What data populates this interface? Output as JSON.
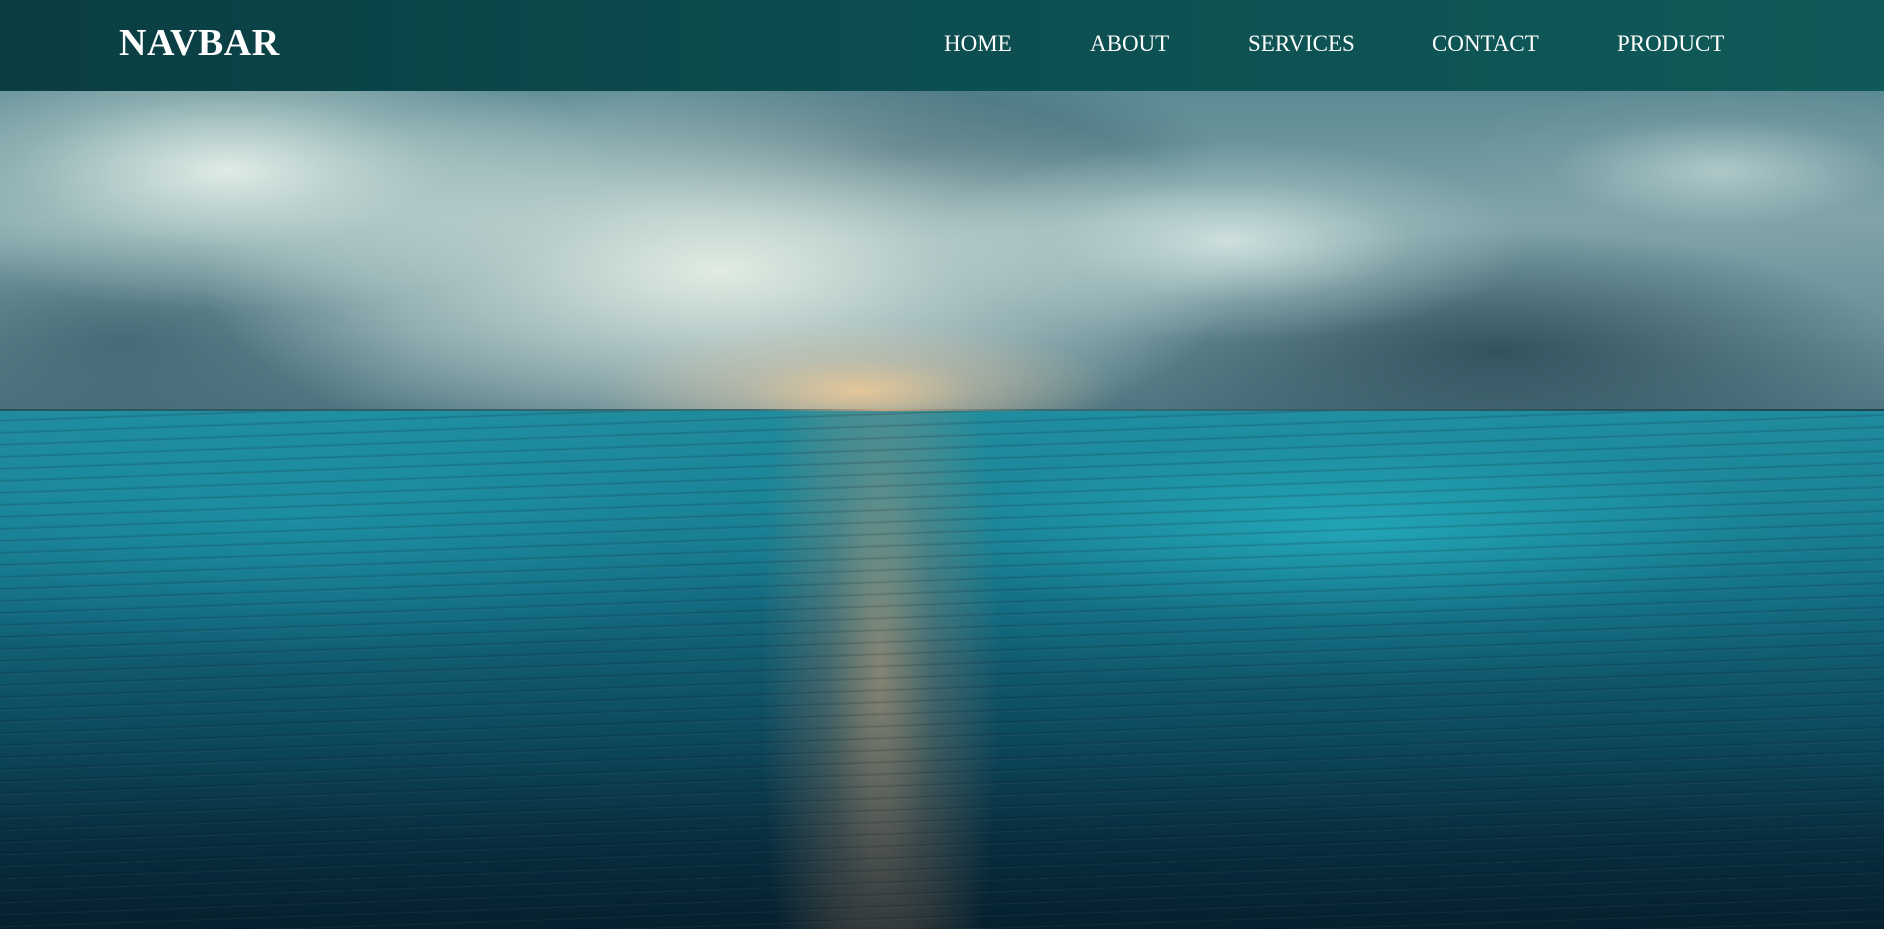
{
  "navbar": {
    "brand": "NAVBAR",
    "links": [
      {
        "label": "HOME"
      },
      {
        "label": "ABOUT"
      },
      {
        "label": "SERVICES"
      },
      {
        "label": "CONTACT"
      },
      {
        "label": "PRODUCT"
      }
    ],
    "background_color": "#0d4e50"
  },
  "hero": {
    "image_subject": "ocean-horizon-under-stormy-sky",
    "colors": {
      "sky": "#7fa3a8",
      "sea": "#1a7f92",
      "sun_glow": "#e6aa78"
    }
  }
}
